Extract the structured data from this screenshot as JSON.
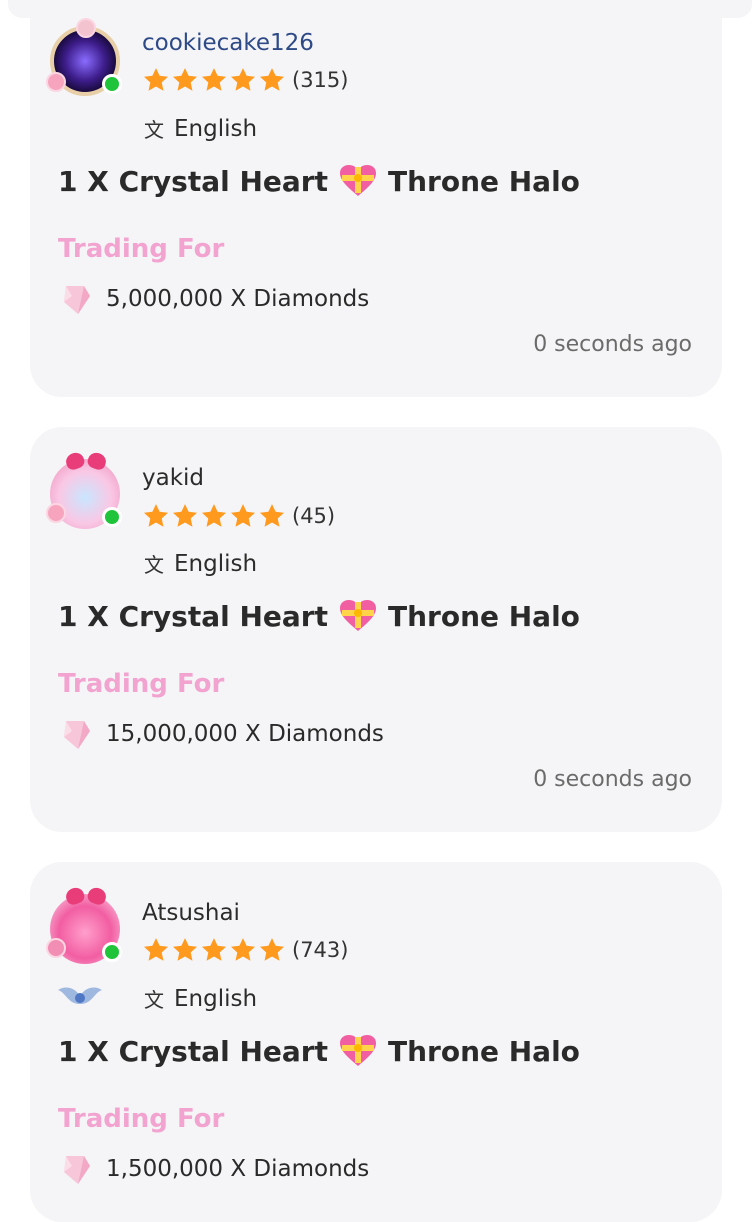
{
  "listings": [
    {
      "username": "cookiecake126",
      "rating_count": "(315)",
      "stars": 5,
      "language": "English",
      "item_prefix": "1 X Crystal Heart",
      "item_suffix": "Throne Halo",
      "trading_label": "Trading For",
      "price": "5,000,000 X Diamonds",
      "time_ago": "0 seconds ago",
      "avatar_style": "cosmic",
      "online": true
    },
    {
      "username": "yakid",
      "rating_count": "(45)",
      "stars": 5,
      "language": "English",
      "item_prefix": "1 X Crystal Heart",
      "item_suffix": "Throne Halo",
      "trading_label": "Trading For",
      "price": "15,000,000 X Diamonds",
      "time_ago": "0 seconds ago",
      "avatar_style": "flower",
      "online": true
    },
    {
      "username": "Atsushai",
      "rating_count": "(743)",
      "stars": 5,
      "language": "English",
      "item_prefix": "1 X Crystal Heart",
      "item_suffix": "Throne Halo",
      "trading_label": "Trading For",
      "price": "1,500,000 X Diamonds",
      "avatar_style": "pinkbow",
      "online": true,
      "has_badge": true
    }
  ],
  "colors": {
    "card_bg": "#f5f5f7",
    "trading_label": "#f2a3d0",
    "star": "#ff9a1f",
    "online": "#1fc43a",
    "username_accent": "#2d4a87"
  },
  "icons": {
    "language": "translate-icon",
    "currency": "diamond-icon",
    "item": "heart-with-ribbon-icon",
    "rating": "star-icon",
    "badge": "wings-badge-icon"
  }
}
